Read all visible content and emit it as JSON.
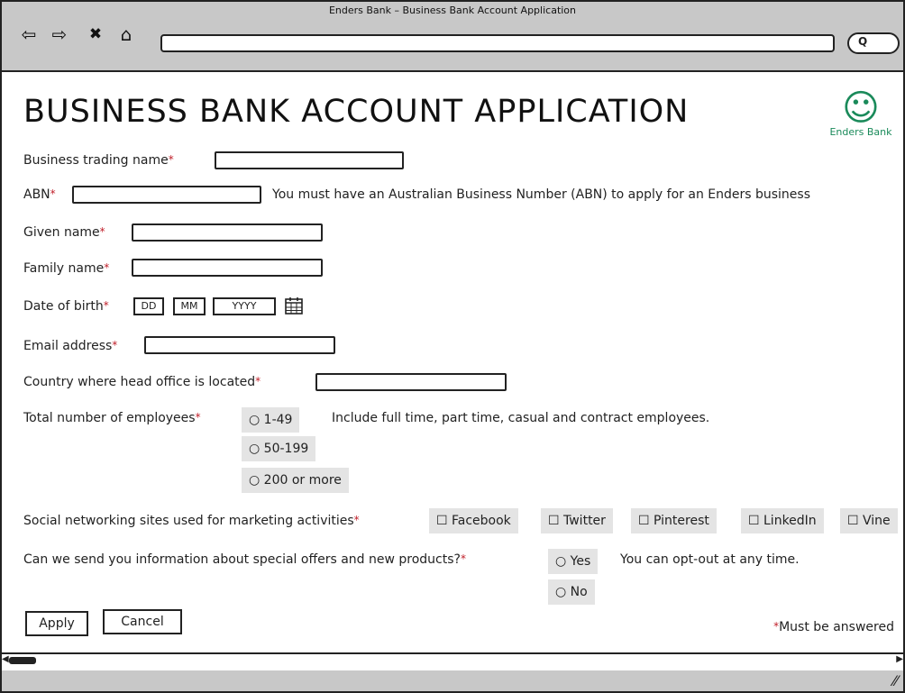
{
  "window": {
    "title": "Enders Bank – Business Bank Account Application"
  },
  "nav": {
    "back": "⇦",
    "forward": "⇨",
    "stop": "✖",
    "home": "⌂",
    "search": "Q"
  },
  "page": {
    "heading": "BUSINESS BANK ACCOUNT APPLICATION",
    "logo": {
      "icon": "smiley-icon",
      "text": "Enders Bank"
    }
  },
  "fields": {
    "trading_name": {
      "label": "Business trading name",
      "value": ""
    },
    "abn": {
      "label": "ABN",
      "value": "",
      "hint": "You must have an Australian Business Number (ABN) to apply for an Enders business"
    },
    "given_name": {
      "label": "Given name",
      "value": ""
    },
    "family_name": {
      "label": "Family name",
      "value": ""
    },
    "dob": {
      "label": "Date of birth",
      "dd": "DD",
      "mm": "MM",
      "yyyy": "YYYY"
    },
    "email": {
      "label": "Email address",
      "value": ""
    },
    "country": {
      "label": "Country where head office is located",
      "value": ""
    },
    "employees": {
      "label": "Total number of employees",
      "hint": "Include full time, part time, casual and contract employees.",
      "options": [
        "○ 1-49",
        "○ 50-199",
        "○ 200 or more"
      ]
    },
    "social": {
      "label": "Social networking sites used for marketing activities",
      "options": [
        "☐ Facebook",
        "☐ Twitter",
        "☐ Pinterest",
        "☐ LinkedIn",
        "☐ Vine"
      ]
    },
    "offers": {
      "label": "Can we send you information about special offers and new products?",
      "hint": "You can opt-out at any time.",
      "options": [
        "○ Yes",
        "○ No"
      ]
    }
  },
  "required_mark": "*",
  "buttons": {
    "apply": "Apply",
    "cancel": "Cancel"
  },
  "legend": {
    "star": "*",
    "text": "Must be answered"
  },
  "colors": {
    "required": "#c0202a",
    "chrome": "#c8c8c8",
    "chip": "#e4e4e4",
    "logo": "#1a8a5a"
  }
}
